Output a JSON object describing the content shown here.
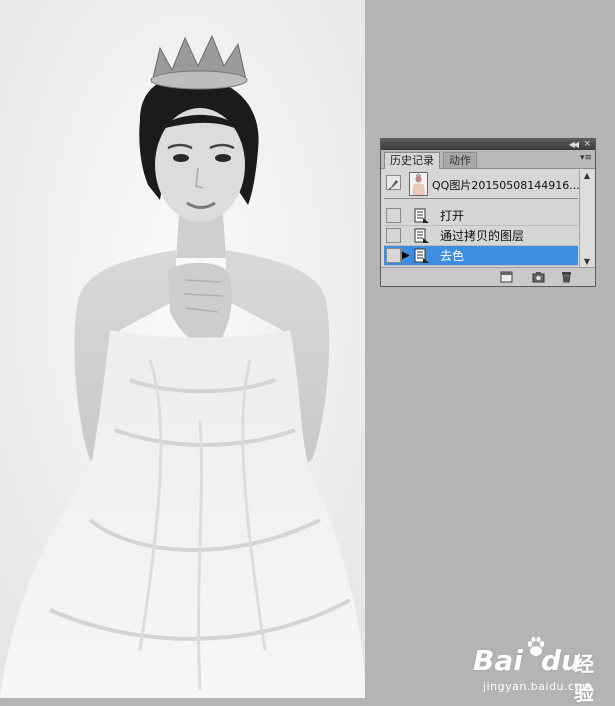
{
  "panel": {
    "tabs": [
      {
        "label": "历史记录",
        "active": true
      },
      {
        "label": "动作",
        "active": false
      }
    ],
    "snapshot": {
      "name": "QQ图片20150508144916...."
    },
    "history": [
      {
        "label": "打开",
        "selected": false
      },
      {
        "label": "通过拷贝的图层",
        "selected": false
      },
      {
        "label": "去色",
        "selected": true
      }
    ],
    "footer_icons": [
      "new-document-from-state-icon",
      "snapshot-camera-icon",
      "trash-icon"
    ]
  },
  "watermark": {
    "text_a": "Bai",
    "text_b": "du",
    "text_c": "经验",
    "url": "jingyan.baidu.com"
  },
  "colors": {
    "selection": "#3d8ee0",
    "workspace": "#b4b4b4",
    "panel": "#d6d6d6"
  }
}
